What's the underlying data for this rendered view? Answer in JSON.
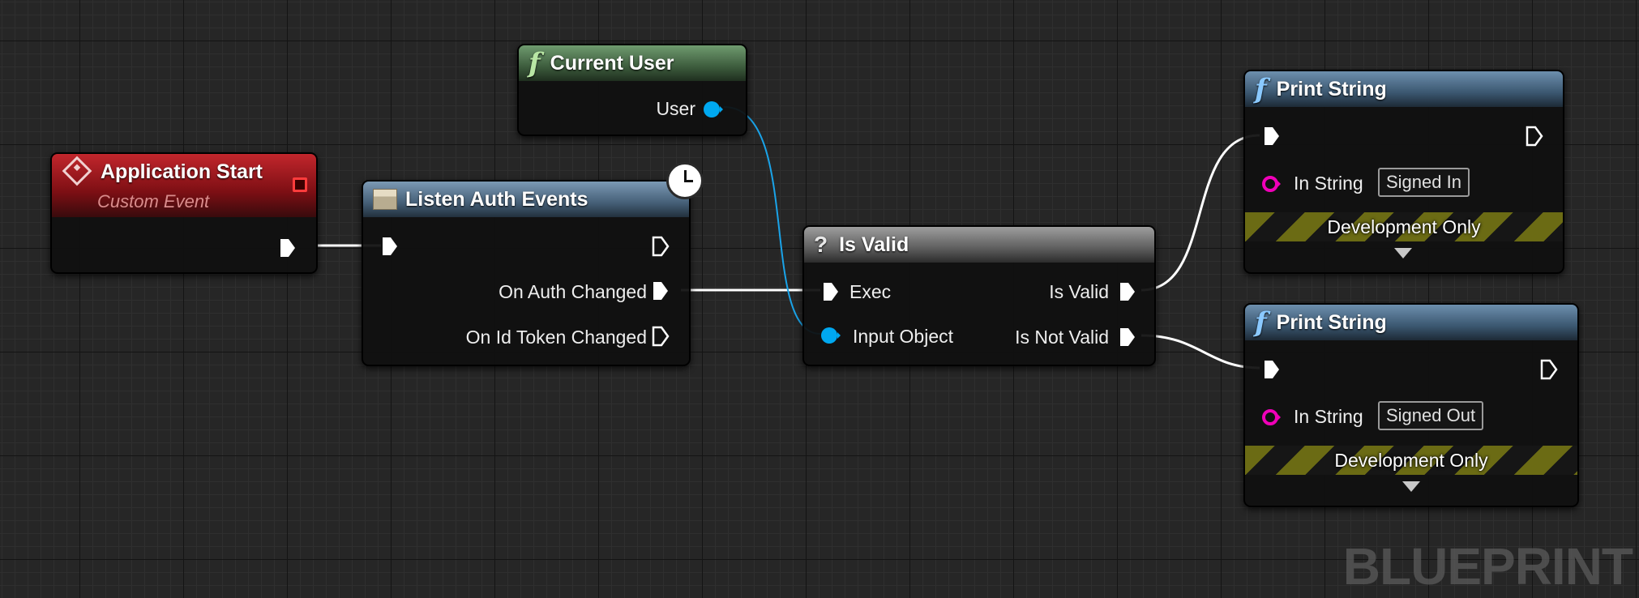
{
  "nodes": {
    "application_start": {
      "title": "Application Start",
      "subtitle": "Custom Event"
    },
    "current_user": {
      "title": "Current User",
      "out_user": "User",
      "func_icon": "f"
    },
    "listen_auth": {
      "title": "Listen Auth Events",
      "out_auth_changed": "On Auth Changed",
      "out_id_token_changed": "On Id Token Changed"
    },
    "is_valid": {
      "title": "Is Valid",
      "icon": "?",
      "in_exec": "Exec",
      "in_object": "Input Object",
      "out_valid": "Is Valid",
      "out_not_valid": "Is Not Valid"
    },
    "print_1": {
      "title": "Print String",
      "func_icon": "f",
      "in_string_label": "In String",
      "in_string_value": "Signed In",
      "band": "Development Only"
    },
    "print_2": {
      "title": "Print String",
      "func_icon": "f",
      "in_string_label": "In String",
      "in_string_value": "Signed Out",
      "band": "Development Only"
    }
  },
  "watermark": "BLUEPRINT",
  "colors": {
    "exec_wire": "#ffffff",
    "object_wire": "#00a8f0",
    "string_pin": "#f000b8",
    "event_header": "#a81c22",
    "function_header_green": "#5e885e",
    "function_header_blue": "#4e6e8c"
  }
}
